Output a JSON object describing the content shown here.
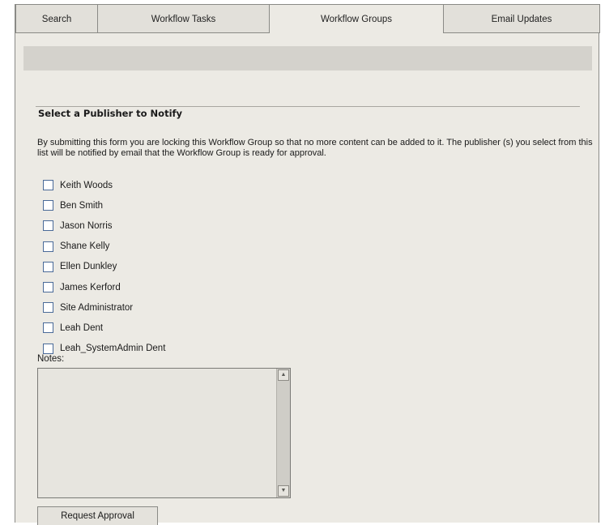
{
  "tabs": [
    {
      "label": "Search",
      "active": false
    },
    {
      "label": "Workflow Tasks",
      "active": false
    },
    {
      "label": "Workflow Groups",
      "active": true
    },
    {
      "label": "Email Updates",
      "active": false
    }
  ],
  "form": {
    "title": "Select a Publisher to Notify",
    "description": "By submitting this form you are locking this Workflow Group so that no more content can be added to it. The publisher (s) you select from this list will be notified by email that the Workflow Group is ready for approval.",
    "publishers": [
      {
        "label": "Keith Woods",
        "checked": false
      },
      {
        "label": "Ben Smith",
        "checked": false
      },
      {
        "label": "Jason Norris",
        "checked": false
      },
      {
        "label": "Shane Kelly",
        "checked": false
      },
      {
        "label": "Ellen Dunkley",
        "checked": false
      },
      {
        "label": "James Kerford",
        "checked": false
      },
      {
        "label": "Site Administrator",
        "checked": false
      },
      {
        "label": "Leah Dent",
        "checked": false
      },
      {
        "label": "Leah_SystemAdmin Dent",
        "checked": false
      }
    ],
    "notes_label": "Notes:",
    "notes_value": "",
    "submit_label": "Request Approval"
  },
  "icons": {
    "scroll_up": "scroll-up-arrow-icon",
    "scroll_down": "scroll-down-arrow-icon"
  },
  "colors": {
    "background": "#eceae4",
    "header_bar": "#d4d2cc",
    "checkbox_border": "#4a6a98"
  }
}
